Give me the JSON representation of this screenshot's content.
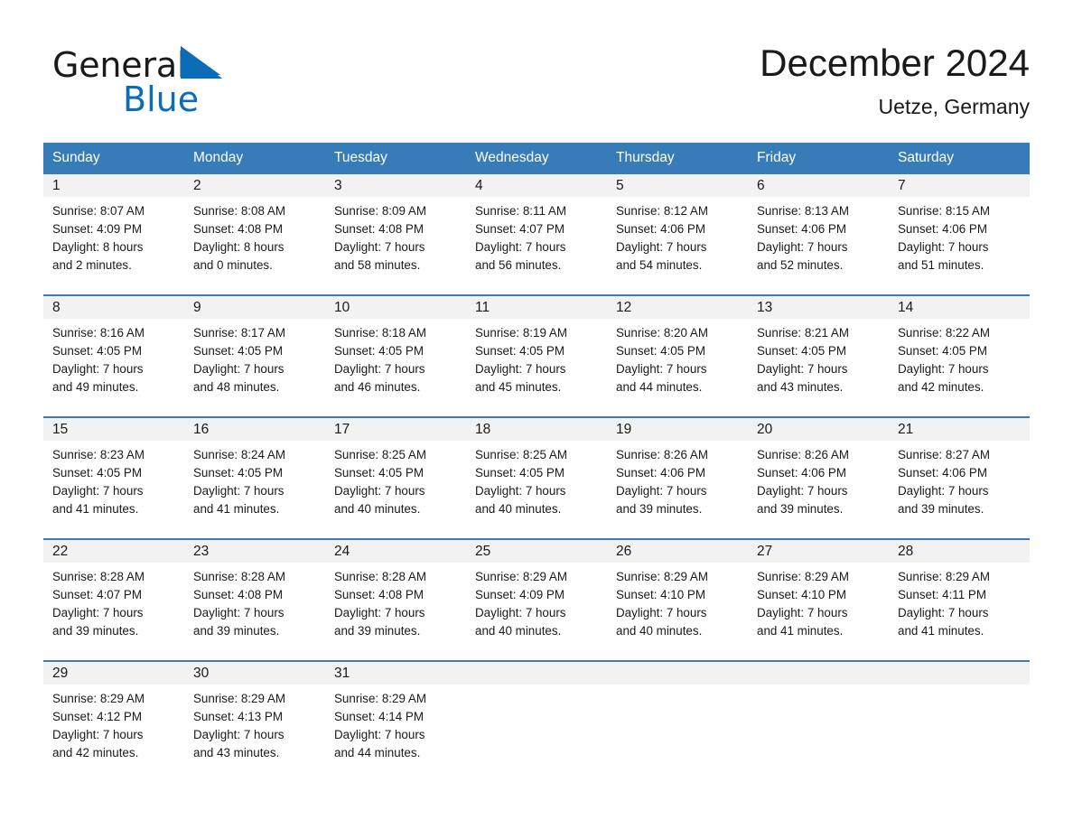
{
  "brand": {
    "name_part1": "General",
    "name_part2": "Blue",
    "triangle_color": "#0b6cb8",
    "text_color": "#1a1a1a"
  },
  "header": {
    "title": "December 2024",
    "location": "Uetze, Germany"
  },
  "theme": {
    "header_blue": "#377cb8",
    "row_divider_blue": "#3a7cb8",
    "date_band_gray": "#f2f2f2",
    "page_background": "#ffffff"
  },
  "calendar": {
    "weekday_headers": [
      "Sunday",
      "Monday",
      "Tuesday",
      "Wednesday",
      "Thursday",
      "Friday",
      "Saturday"
    ],
    "weeks": [
      {
        "dates": [
          "1",
          "2",
          "3",
          "4",
          "5",
          "6",
          "7"
        ],
        "cells": [
          {
            "sunrise": "Sunrise: 8:07 AM",
            "sunset": "Sunset: 4:09 PM",
            "daylight1": "Daylight: 8 hours",
            "daylight2": "and 2 minutes."
          },
          {
            "sunrise": "Sunrise: 8:08 AM",
            "sunset": "Sunset: 4:08 PM",
            "daylight1": "Daylight: 8 hours",
            "daylight2": "and 0 minutes."
          },
          {
            "sunrise": "Sunrise: 8:09 AM",
            "sunset": "Sunset: 4:08 PM",
            "daylight1": "Daylight: 7 hours",
            "daylight2": "and 58 minutes."
          },
          {
            "sunrise": "Sunrise: 8:11 AM",
            "sunset": "Sunset: 4:07 PM",
            "daylight1": "Daylight: 7 hours",
            "daylight2": "and 56 minutes."
          },
          {
            "sunrise": "Sunrise: 8:12 AM",
            "sunset": "Sunset: 4:06 PM",
            "daylight1": "Daylight: 7 hours",
            "daylight2": "and 54 minutes."
          },
          {
            "sunrise": "Sunrise: 8:13 AM",
            "sunset": "Sunset: 4:06 PM",
            "daylight1": "Daylight: 7 hours",
            "daylight2": "and 52 minutes."
          },
          {
            "sunrise": "Sunrise: 8:15 AM",
            "sunset": "Sunset: 4:06 PM",
            "daylight1": "Daylight: 7 hours",
            "daylight2": "and 51 minutes."
          }
        ]
      },
      {
        "dates": [
          "8",
          "9",
          "10",
          "11",
          "12",
          "13",
          "14"
        ],
        "cells": [
          {
            "sunrise": "Sunrise: 8:16 AM",
            "sunset": "Sunset: 4:05 PM",
            "daylight1": "Daylight: 7 hours",
            "daylight2": "and 49 minutes."
          },
          {
            "sunrise": "Sunrise: 8:17 AM",
            "sunset": "Sunset: 4:05 PM",
            "daylight1": "Daylight: 7 hours",
            "daylight2": "and 48 minutes."
          },
          {
            "sunrise": "Sunrise: 8:18 AM",
            "sunset": "Sunset: 4:05 PM",
            "daylight1": "Daylight: 7 hours",
            "daylight2": "and 46 minutes."
          },
          {
            "sunrise": "Sunrise: 8:19 AM",
            "sunset": "Sunset: 4:05 PM",
            "daylight1": "Daylight: 7 hours",
            "daylight2": "and 45 minutes."
          },
          {
            "sunrise": "Sunrise: 8:20 AM",
            "sunset": "Sunset: 4:05 PM",
            "daylight1": "Daylight: 7 hours",
            "daylight2": "and 44 minutes."
          },
          {
            "sunrise": "Sunrise: 8:21 AM",
            "sunset": "Sunset: 4:05 PM",
            "daylight1": "Daylight: 7 hours",
            "daylight2": "and 43 minutes."
          },
          {
            "sunrise": "Sunrise: 8:22 AM",
            "sunset": "Sunset: 4:05 PM",
            "daylight1": "Daylight: 7 hours",
            "daylight2": "and 42 minutes."
          }
        ]
      },
      {
        "dates": [
          "15",
          "16",
          "17",
          "18",
          "19",
          "20",
          "21"
        ],
        "cells": [
          {
            "sunrise": "Sunrise: 8:23 AM",
            "sunset": "Sunset: 4:05 PM",
            "daylight1": "Daylight: 7 hours",
            "daylight2": "and 41 minutes."
          },
          {
            "sunrise": "Sunrise: 8:24 AM",
            "sunset": "Sunset: 4:05 PM",
            "daylight1": "Daylight: 7 hours",
            "daylight2": "and 41 minutes."
          },
          {
            "sunrise": "Sunrise: 8:25 AM",
            "sunset": "Sunset: 4:05 PM",
            "daylight1": "Daylight: 7 hours",
            "daylight2": "and 40 minutes."
          },
          {
            "sunrise": "Sunrise: 8:25 AM",
            "sunset": "Sunset: 4:05 PM",
            "daylight1": "Daylight: 7 hours",
            "daylight2": "and 40 minutes."
          },
          {
            "sunrise": "Sunrise: 8:26 AM",
            "sunset": "Sunset: 4:06 PM",
            "daylight1": "Daylight: 7 hours",
            "daylight2": "and 39 minutes."
          },
          {
            "sunrise": "Sunrise: 8:26 AM",
            "sunset": "Sunset: 4:06 PM",
            "daylight1": "Daylight: 7 hours",
            "daylight2": "and 39 minutes."
          },
          {
            "sunrise": "Sunrise: 8:27 AM",
            "sunset": "Sunset: 4:06 PM",
            "daylight1": "Daylight: 7 hours",
            "daylight2": "and 39 minutes."
          }
        ]
      },
      {
        "dates": [
          "22",
          "23",
          "24",
          "25",
          "26",
          "27",
          "28"
        ],
        "cells": [
          {
            "sunrise": "Sunrise: 8:28 AM",
            "sunset": "Sunset: 4:07 PM",
            "daylight1": "Daylight: 7 hours",
            "daylight2": "and 39 minutes."
          },
          {
            "sunrise": "Sunrise: 8:28 AM",
            "sunset": "Sunset: 4:08 PM",
            "daylight1": "Daylight: 7 hours",
            "daylight2": "and 39 minutes."
          },
          {
            "sunrise": "Sunrise: 8:28 AM",
            "sunset": "Sunset: 4:08 PM",
            "daylight1": "Daylight: 7 hours",
            "daylight2": "and 39 minutes."
          },
          {
            "sunrise": "Sunrise: 8:29 AM",
            "sunset": "Sunset: 4:09 PM",
            "daylight1": "Daylight: 7 hours",
            "daylight2": "and 40 minutes."
          },
          {
            "sunrise": "Sunrise: 8:29 AM",
            "sunset": "Sunset: 4:10 PM",
            "daylight1": "Daylight: 7 hours",
            "daylight2": "and 40 minutes."
          },
          {
            "sunrise": "Sunrise: 8:29 AM",
            "sunset": "Sunset: 4:10 PM",
            "daylight1": "Daylight: 7 hours",
            "daylight2": "and 41 minutes."
          },
          {
            "sunrise": "Sunrise: 8:29 AM",
            "sunset": "Sunset: 4:11 PM",
            "daylight1": "Daylight: 7 hours",
            "daylight2": "and 41 minutes."
          }
        ]
      },
      {
        "dates": [
          "29",
          "30",
          "31",
          "",
          "",
          "",
          ""
        ],
        "cells": [
          {
            "sunrise": "Sunrise: 8:29 AM",
            "sunset": "Sunset: 4:12 PM",
            "daylight1": "Daylight: 7 hours",
            "daylight2": "and 42 minutes."
          },
          {
            "sunrise": "Sunrise: 8:29 AM",
            "sunset": "Sunset: 4:13 PM",
            "daylight1": "Daylight: 7 hours",
            "daylight2": "and 43 minutes."
          },
          {
            "sunrise": "Sunrise: 8:29 AM",
            "sunset": "Sunset: 4:14 PM",
            "daylight1": "Daylight: 7 hours",
            "daylight2": "and 44 minutes."
          },
          {
            "sunrise": "",
            "sunset": "",
            "daylight1": "",
            "daylight2": ""
          },
          {
            "sunrise": "",
            "sunset": "",
            "daylight1": "",
            "daylight2": ""
          },
          {
            "sunrise": "",
            "sunset": "",
            "daylight1": "",
            "daylight2": ""
          },
          {
            "sunrise": "",
            "sunset": "",
            "daylight1": "",
            "daylight2": ""
          }
        ]
      }
    ]
  }
}
